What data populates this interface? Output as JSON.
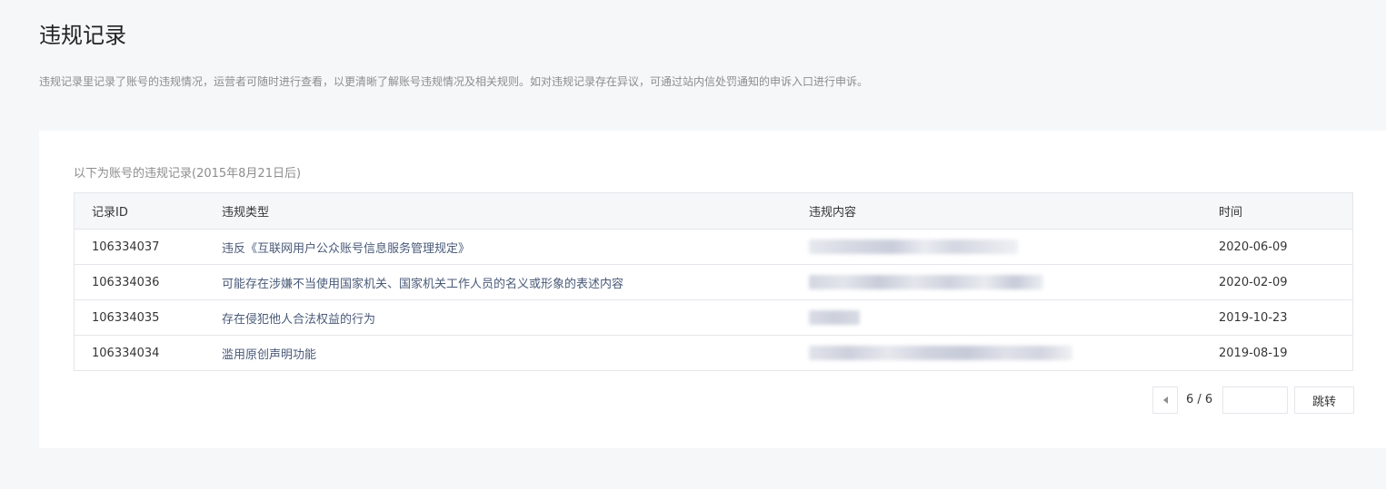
{
  "page": {
    "title": "违规记录",
    "description": "违规记录里记录了账号的违规情况，运营者可随时进行查看，以更清晰了解账号违规情况及相关规则。如对违规记录存在异议，可通过站内信处罚通知的申诉入口进行申诉。"
  },
  "card": {
    "caption": "以下为账号的违规记录(2015年8月21日后)"
  },
  "table": {
    "headers": {
      "id": "记录ID",
      "type": "违规类型",
      "content": "违规内容",
      "time": "时间"
    },
    "rows": [
      {
        "id": "106334037",
        "type": "违反《互联网用户公众账号信息服务管理规定》",
        "time": "2020-06-09"
      },
      {
        "id": "106334036",
        "type": "可能存在涉嫌不当使用国家机关、国家机关工作人员的名义或形象的表述内容",
        "time": "2020-02-09"
      },
      {
        "id": "106334035",
        "type": "存在侵犯他人合法权益的行为",
        "time": "2019-10-23"
      },
      {
        "id": "106334034",
        "type": "滥用原创声明功能",
        "time": "2019-08-19"
      }
    ]
  },
  "pagination": {
    "info": "6 / 6",
    "input_value": "",
    "jump_label": "跳转",
    "prev_icon": "caret-left-icon"
  },
  "colors": {
    "background": "#f6f7f9",
    "card": "#ffffff",
    "border": "#e4e6eb",
    "type_text": "#4a5a78",
    "muted_text": "#8d8d8d"
  }
}
